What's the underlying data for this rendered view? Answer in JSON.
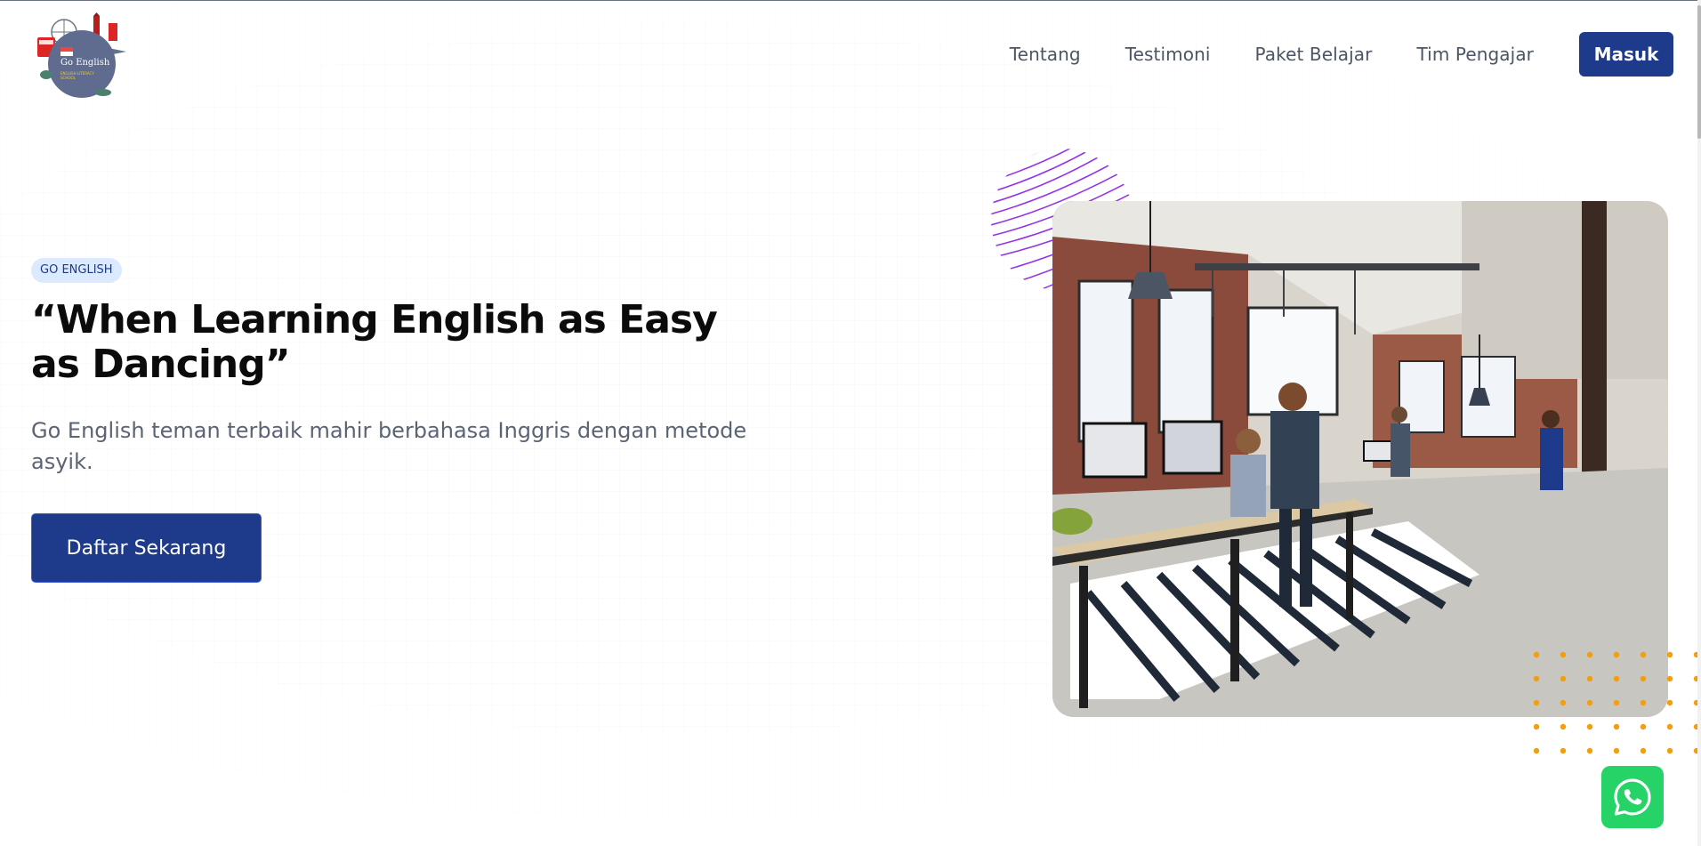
{
  "header": {
    "logo": {
      "title": "Go English",
      "subtitle": "ENGLISH LITERACY SCHOOL"
    },
    "nav": [
      {
        "label": "Tentang"
      },
      {
        "label": "Testimoni"
      },
      {
        "label": "Paket Belajar"
      },
      {
        "label": "Tim Pengajar"
      }
    ],
    "login_label": "Masuk"
  },
  "hero": {
    "badge": "GO ENGLISH",
    "title": "“When Learning English as Easy as Dancing”",
    "subtitle": "Go English teman terbaik mahir berbahasa Inggris dengan metode asyik.",
    "cta_label": "Daftar Sekarang",
    "image": "office-coworking-photo"
  },
  "floating": {
    "whatsapp_icon": "whatsapp-icon"
  },
  "colors": {
    "primary": "#1e3a8a",
    "badge_bg": "#dbeafe",
    "accent_purple": "#9333ea",
    "accent_orange": "#f59e0b",
    "whatsapp": "#25d366"
  }
}
